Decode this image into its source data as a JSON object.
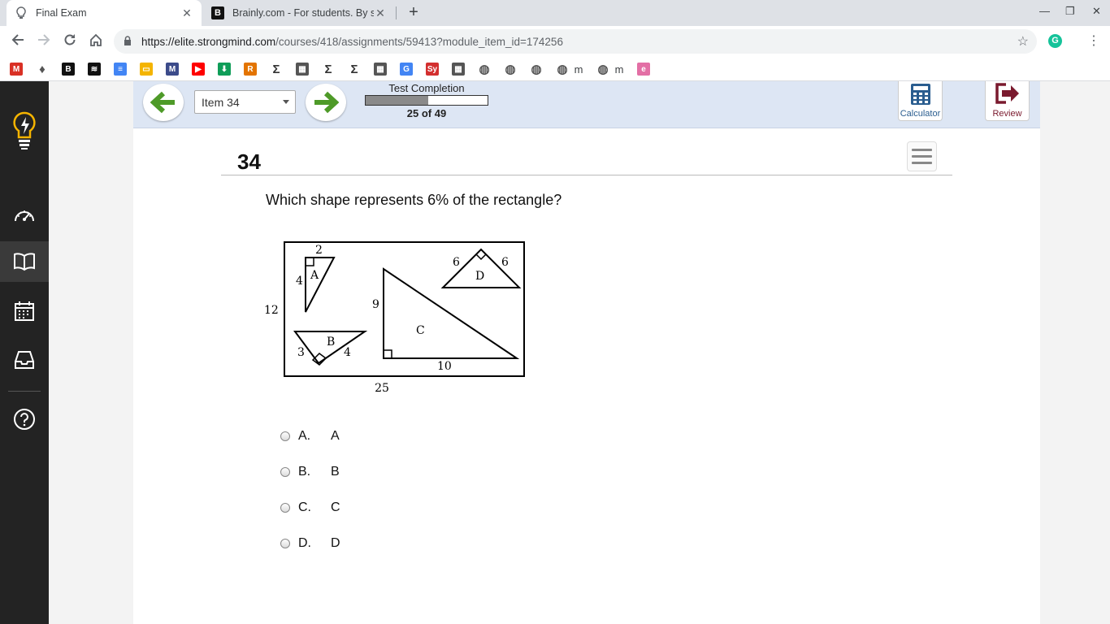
{
  "browser": {
    "tabs": [
      {
        "title": "Final Exam",
        "active": true,
        "icon": "lightbulb-icon"
      },
      {
        "title": "Brainly.com - For students. By st",
        "active": false,
        "icon": "brainly-icon"
      }
    ],
    "url_host": "https://elite.strongmind.com",
    "url_path": "/courses/418/assignments/59413?module_item_id=174256",
    "bookmarks": [
      {
        "icon": "gmail-icon",
        "color": "#d93025"
      },
      {
        "icon": "lightbulb-icon",
        "color": "#555555"
      },
      {
        "icon": "brainly-icon",
        "color": "#111111"
      },
      {
        "icon": "spotify-icon",
        "color": "#111111"
      },
      {
        "icon": "docs-icon",
        "color": "#4285f4"
      },
      {
        "icon": "slides-icon",
        "color": "#f4b400"
      },
      {
        "icon": "mathway-icon",
        "color": "#3c4b8a"
      },
      {
        "icon": "youtube-icon",
        "color": "#ff0000"
      },
      {
        "icon": "download-icon",
        "color": "#0f9d58"
      },
      {
        "icon": "r-icon",
        "color": "#e37400"
      },
      {
        "icon": "sigma-icon",
        "color": "#333333"
      },
      {
        "icon": "calc-icon",
        "color": "#555555"
      },
      {
        "icon": "sigma-icon",
        "color": "#333333"
      },
      {
        "icon": "sigma-icon",
        "color": "#333333"
      },
      {
        "icon": "calculator-icon",
        "color": "#555555"
      },
      {
        "icon": "translate-icon",
        "color": "#4285f4"
      },
      {
        "icon": "symbolab-icon",
        "color": "#d32f2f"
      },
      {
        "icon": "calculator-icon",
        "color": "#555555"
      },
      {
        "icon": "globe-icon",
        "color": "#555555"
      },
      {
        "icon": "globe-icon",
        "color": "#555555"
      },
      {
        "icon": "globe-icon",
        "color": "#555555"
      },
      {
        "icon": "globe-icon",
        "color": "#555555",
        "label": "m"
      },
      {
        "icon": "globe-icon",
        "color": "#555555",
        "label": "m"
      },
      {
        "icon": "ext-icon",
        "color": "#e36fa5"
      }
    ],
    "grammarly_letter": "G"
  },
  "toolbar": {
    "item_select": "Item 34",
    "progress_title": "Test Completion",
    "progress_fraction": 0.51,
    "progress_count": "25 of 49",
    "calculator_label": "Calculator",
    "review_label": "Review"
  },
  "question": {
    "number": "34",
    "text": "Which shape represents 6% of the rectangle?",
    "figure_labels": {
      "rect_width": "25",
      "rect_height": "12",
      "a_top": "2",
      "a_side": "4",
      "a_name": "A",
      "b_left": "3",
      "b_right": "4",
      "b_name": "B",
      "c_height": "9",
      "c_base": "10",
      "c_name": "C",
      "d_left": "6",
      "d_right": "6",
      "d_name": "D"
    },
    "choices": [
      {
        "letter": "A.",
        "text": "A"
      },
      {
        "letter": "B.",
        "text": "B"
      },
      {
        "letter": "C.",
        "text": "C"
      },
      {
        "letter": "D.",
        "text": "D"
      }
    ]
  }
}
